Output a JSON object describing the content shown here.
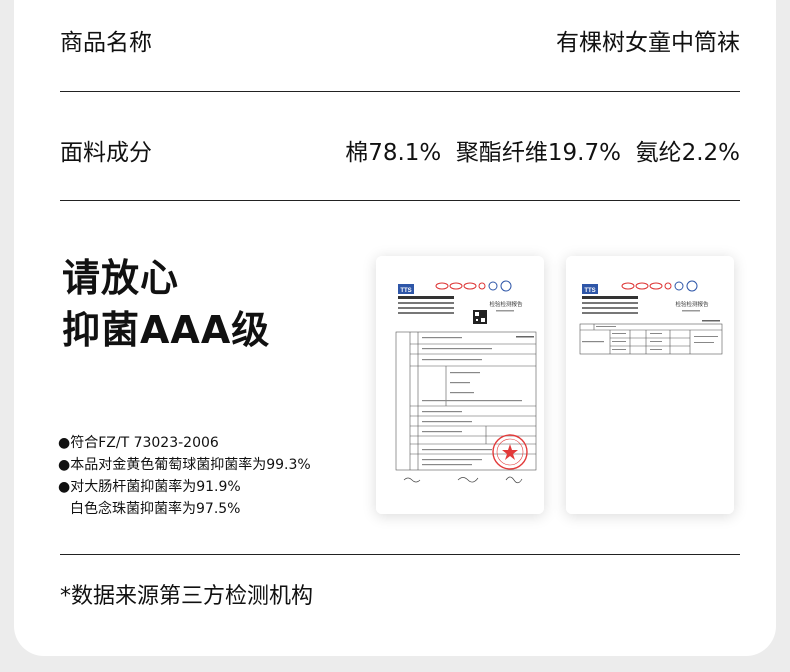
{
  "rows": [
    {
      "label": "商品名称",
      "value": "有棵树女童中筒袜"
    },
    {
      "label": "面料成分",
      "value": "棉78.1%  聚酯纤维19.7%  氨纶2.2%"
    }
  ],
  "heading": {
    "line1": "请放心",
    "line2": "抑菌AAA级"
  },
  "bullets": [
    "●符合FZ/T 73023-2006",
    "●本品对金黄色葡萄球菌抑菌率为99.3%",
    "●对大肠杆菌抑菌率为91.9%",
    "白色念珠菌抑菌率为97.5%"
  ],
  "report": {
    "logo": "TTS",
    "title": "检验检测报告"
  },
  "footnote": "*数据来源第三方检测机构"
}
